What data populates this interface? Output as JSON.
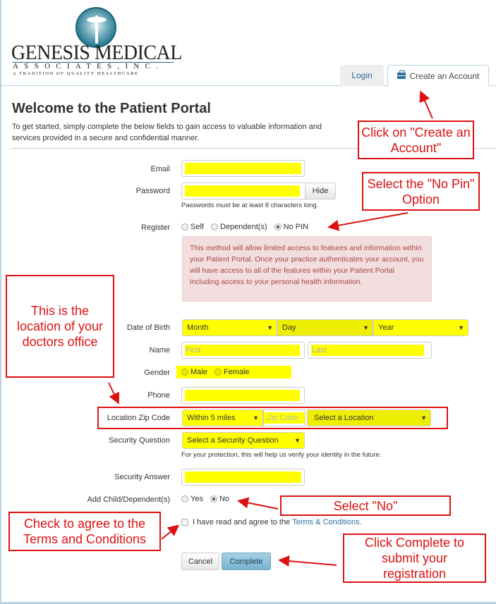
{
  "logo": {
    "name": "GENESIS MEDICAL",
    "subname": "ASSOCIATES,INC.",
    "tagline": "A TRADITION OF QUALITY HEALTHCARE"
  },
  "tabs": [
    {
      "label": "Login",
      "active": false
    },
    {
      "label": "Create an Account",
      "active": true,
      "icon": "briefcase-icon"
    }
  ],
  "header": {
    "title": "Welcome to the Patient Portal",
    "intro": "To get started, simply complete the below fields to gain access to valuable information and services provided in a secure and confidential manner."
  },
  "form": {
    "email": {
      "label": "Email",
      "value": ""
    },
    "password": {
      "label": "Password",
      "value": "",
      "hide_label": "Hide",
      "help": "Passwords must be at least 8 characters long."
    },
    "register": {
      "label": "Register",
      "options": [
        {
          "label": "Self",
          "checked": false
        },
        {
          "label": "Dependent(s)",
          "checked": false
        },
        {
          "label": "No PIN",
          "checked": true
        }
      ],
      "notice": "This method will allow limited access to features and information within your Patient Portal. Once your practice authenticates your account, you will have access to all of the features within your Patient Portal including access to your personal health information."
    },
    "dob": {
      "label": "Date of Birth",
      "month": "Month",
      "day": "Day",
      "year": "Year"
    },
    "name": {
      "label": "Name",
      "first_placeholder": "First",
      "last_placeholder": "Last"
    },
    "gender": {
      "label": "Gender",
      "options": [
        {
          "label": "Male",
          "checked": false
        },
        {
          "label": "Female",
          "checked": false
        }
      ]
    },
    "phone": {
      "label": "Phone",
      "value": ""
    },
    "location": {
      "label": "Location Zip Code",
      "radius": "Within 5 miles",
      "zip_placeholder": "Zip Code",
      "location": "Select a Location"
    },
    "security_question": {
      "label": "Security Question",
      "value": "Select a Security Question",
      "help": "For your protection, this will help us verify your identity in the future."
    },
    "security_answer": {
      "label": "Security Answer",
      "value": ""
    },
    "add_child": {
      "label": "Add Child/Dependent(s)",
      "options": [
        {
          "label": "Yes",
          "checked": false
        },
        {
          "label": "No",
          "checked": true
        }
      ]
    },
    "terms": {
      "text": "I have read and agree to the",
      "link": "Terms & Conditions.",
      "checked": false
    },
    "cancel_label": "Cancel",
    "complete_label": "Complete"
  },
  "annotations": {
    "create_account": "Click on \"Create an Account\"",
    "no_pin": "Select the \"No Pin\" Option",
    "location": "This is the location of your doctors office",
    "select_no": "Select \"No\"",
    "terms": "Check to agree to the Terms and Conditions",
    "complete": "Click Complete to submit your registration",
    "color": "#dd1111"
  }
}
